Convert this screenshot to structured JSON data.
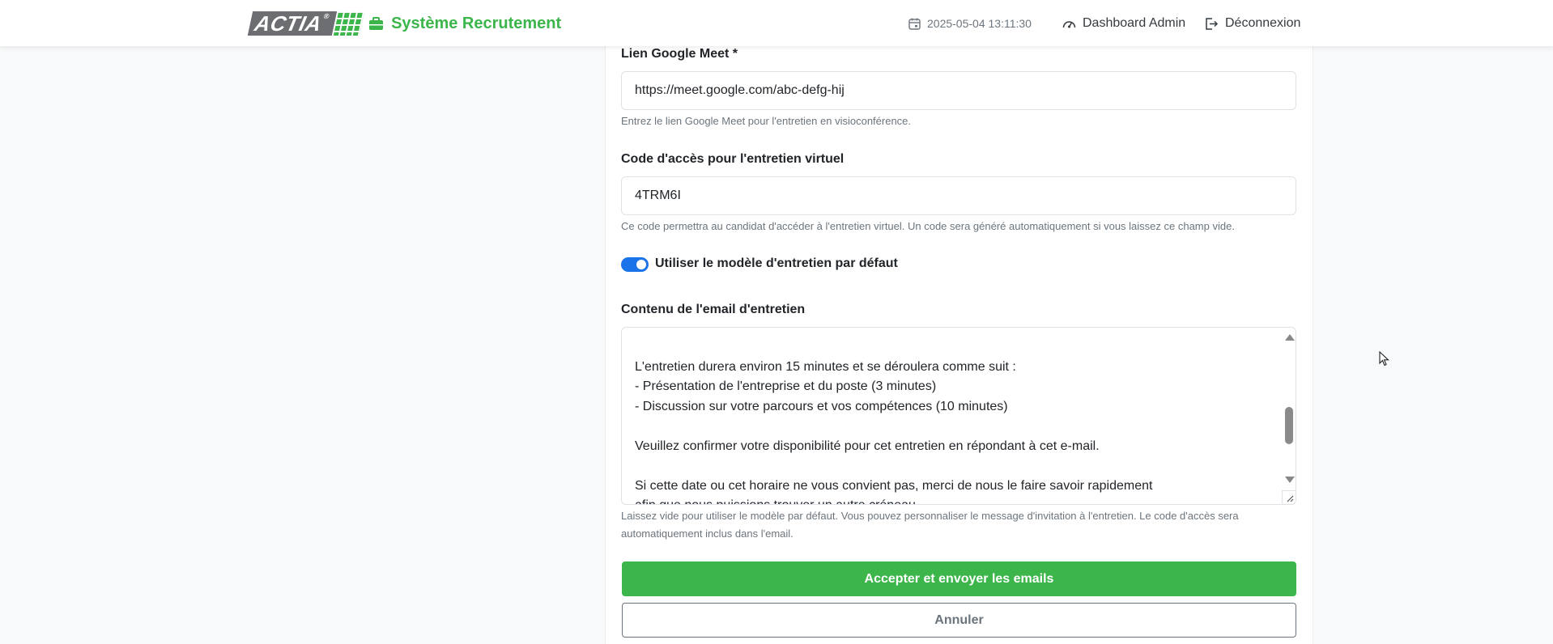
{
  "navbar": {
    "logo_text": "ACTIA",
    "logo_mark": "®",
    "brand_icon": "briefcase-icon",
    "brand_title": "Système Recrutement",
    "datetime_icon": "calendar-icon",
    "datetime": "2025-05-04 13:11:30",
    "dashboard_icon": "speedometer-icon",
    "dashboard_label": "Dashboard Admin",
    "logout_icon": "logout-icon",
    "logout_label": "Déconnexion"
  },
  "form": {
    "meet": {
      "label": "Lien Google Meet *",
      "value": "https://meet.google.com/abc-defg-hij",
      "help": "Entrez le lien Google Meet pour l'entretien en visioconférence."
    },
    "access_code": {
      "label": "Code d'accès pour l'entretien virtuel",
      "value": "4TRM6I",
      "help": "Ce code permettra au candidat d'accéder à l'entretien virtuel. Un code sera généré automatiquement si vous laissez ce champ vide."
    },
    "default_template": {
      "label": "Utiliser le modèle d'entretien par défaut",
      "checked": true
    },
    "email_content": {
      "label": "Contenu de l'email d'entretien",
      "lines": [
        "",
        "L'entretien durera environ 15 minutes et se déroulera comme suit :",
        "- Présentation de l'entreprise et du poste (3 minutes)",
        "- Discussion sur votre parcours et vos compétences (10 minutes)",
        "",
        "Veuillez confirmer votre disponibilité pour cet entretien en répondant à cet e-mail.",
        "",
        "Si cette date ou cet horaire ne vous convient pas, merci de nous le faire savoir rapidement",
        "afin que nous puissions trouver un autre créneau."
      ],
      "help_line1": "Laissez vide pour utiliser le modèle par défaut. Vous pouvez personnaliser le message d'invitation à l'entretien. Le code d'accès sera",
      "help_line2": "automatiquement inclus dans l'email."
    },
    "submit_label": "Accepter et envoyer les emails",
    "cancel_label": "Annuler"
  },
  "colors": {
    "brand_green": "#3cb54a",
    "toggle_blue": "#1a73e8",
    "logo_gray": "#6d6e71"
  }
}
